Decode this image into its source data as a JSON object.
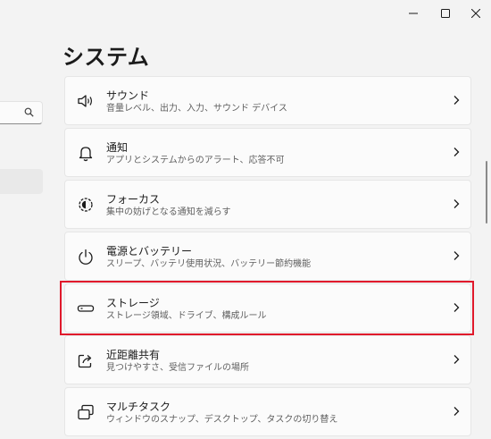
{
  "window": {
    "controls": {
      "minimize": "minimize-icon",
      "maximize": "maximize-icon",
      "close": "close-icon"
    }
  },
  "sidebar": {
    "search_icon": "search-icon"
  },
  "page": {
    "title": "システム"
  },
  "cards": [
    {
      "icon": "speaker-icon",
      "title": "サウンド",
      "subtitle": "音量レベル、出力、入力、サウンド デバイス"
    },
    {
      "icon": "bell-icon",
      "title": "通知",
      "subtitle": "アプリとシステムからのアラート、応答不可"
    },
    {
      "icon": "focus-icon",
      "title": "フォーカス",
      "subtitle": "集中の妨げとなる通知を減らす"
    },
    {
      "icon": "power-icon",
      "title": "電源とバッテリー",
      "subtitle": "スリープ、バッテリ使用状況、バッテリー節約機能"
    },
    {
      "icon": "storage-icon",
      "title": "ストレージ",
      "subtitle": "ストレージ領域、ドライブ、構成ルール"
    },
    {
      "icon": "share-icon",
      "title": "近距離共有",
      "subtitle": "見つけやすさ、受信ファイルの場所"
    },
    {
      "icon": "multitask-icon",
      "title": "マルチタスク",
      "subtitle": "ウィンドウのスナップ、デスクトップ、タスクの切り替え"
    }
  ],
  "highlight": {
    "color": "#e0192b",
    "target": "ストレージ"
  }
}
